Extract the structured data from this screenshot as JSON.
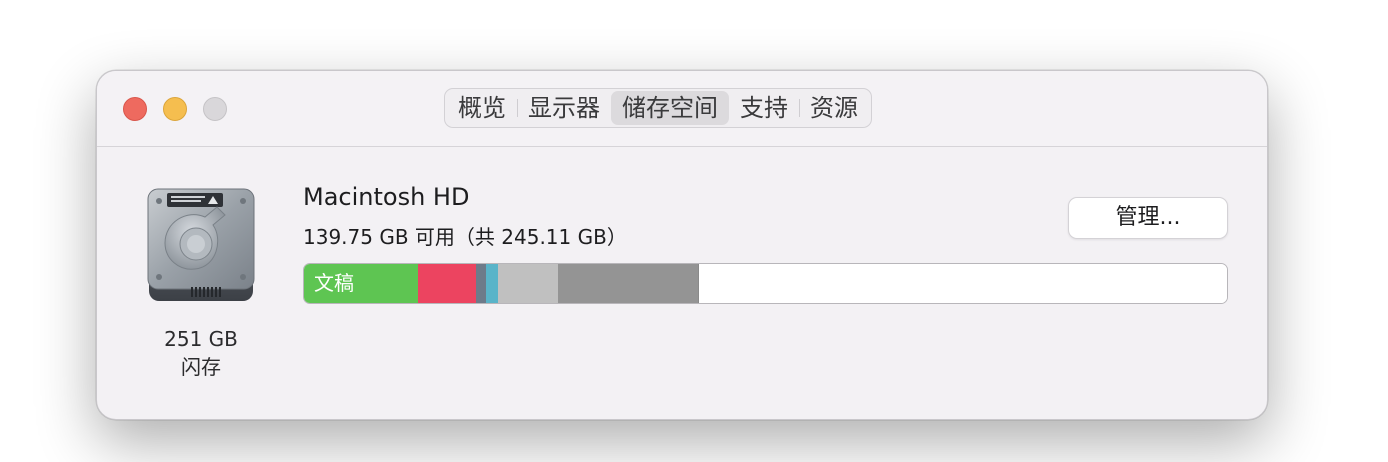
{
  "window": {
    "tabs": [
      {
        "label": "概览"
      },
      {
        "label": "显示器"
      },
      {
        "label": "储存空间",
        "active": true
      },
      {
        "label": "支持"
      },
      {
        "label": "资源"
      }
    ]
  },
  "disk": {
    "icon": "hard-drive-icon",
    "size": "251 GB",
    "type": "闪存"
  },
  "volume": {
    "name": "Macintosh HD",
    "available": "139.75 GB 可用（共 245.11 GB）",
    "manage_label": "管理..."
  },
  "storage_bar": {
    "segments": [
      {
        "name": "documents",
        "label": "文稿",
        "color": "#5ec552",
        "fraction": 0.123
      },
      {
        "name": "apps",
        "label": "",
        "color": "#ec4460",
        "fraction": 0.063
      },
      {
        "name": "segment-3",
        "label": "",
        "color": "#6d7b8a",
        "fraction": 0.011
      },
      {
        "name": "segment-4",
        "label": "",
        "color": "#59b4c9",
        "fraction": 0.013
      },
      {
        "name": "other",
        "label": "",
        "color": "#c0c0c0",
        "fraction": 0.065
      },
      {
        "name": "system",
        "label": "",
        "color": "#949494",
        "fraction": 0.152
      }
    ],
    "free_color": "#ffffff"
  },
  "colors": {
    "close": "#ee6a5f",
    "minimize": "#f5be4f",
    "maximize": "#d9d7da"
  }
}
